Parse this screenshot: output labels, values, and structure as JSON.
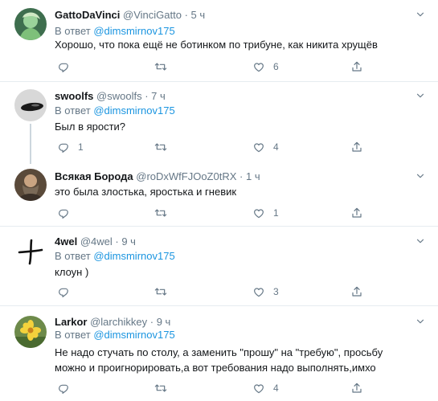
{
  "tweets": [
    {
      "name": "GattoDaVinci",
      "handle": "@VinciGatto",
      "time": "5 ч",
      "reply_prefix": "В ответ",
      "reply_to": "@dimsmirnov175",
      "text": "Хорошо, что пока ещё не ботинком по трибуне, как никита хрущёв",
      "replies": "",
      "retweets": "",
      "likes": "6"
    },
    {
      "name": "swoolfs",
      "handle": "@swoolfs",
      "time": "7 ч",
      "reply_prefix": "В ответ",
      "reply_to": "@dimsmirnov175",
      "text": "Был в ярости?",
      "replies": "1",
      "retweets": "",
      "likes": "4"
    },
    {
      "name": "Всякая Борода",
      "handle": "@roDxWfFJOoZ0tRX",
      "time": "1 ч",
      "reply_prefix": "",
      "reply_to": "",
      "text": "это была злостька, яростька и гневик",
      "replies": "",
      "retweets": "",
      "likes": "1"
    },
    {
      "name": "4wel",
      "handle": "@4wel",
      "time": "9 ч",
      "reply_prefix": "В ответ",
      "reply_to": "@dimsmirnov175",
      "text": "клоун )",
      "replies": "",
      "retweets": "",
      "likes": "3"
    },
    {
      "name": "Larkor",
      "handle": "@larchikkey",
      "time": "9 ч",
      "reply_prefix": "В ответ",
      "reply_to": "@dimsmirnov175",
      "text_line1": "Не надо стучать по столу, а заменить \"прошу\" на \"требую\", просьбу",
      "text_line2": "можно и проигнорировать,а вот требования надо выполнять,имхо",
      "replies": "",
      "retweets": "",
      "likes": "4"
    }
  ],
  "separator": "·",
  "icons": [
    "reply-icon",
    "retweet-icon",
    "like-icon",
    "share-icon",
    "caret-down-icon"
  ],
  "colors": {
    "link": "#1b95e0",
    "muted": "#657786",
    "text": "#14171a",
    "divider": "#e6ecf0"
  }
}
